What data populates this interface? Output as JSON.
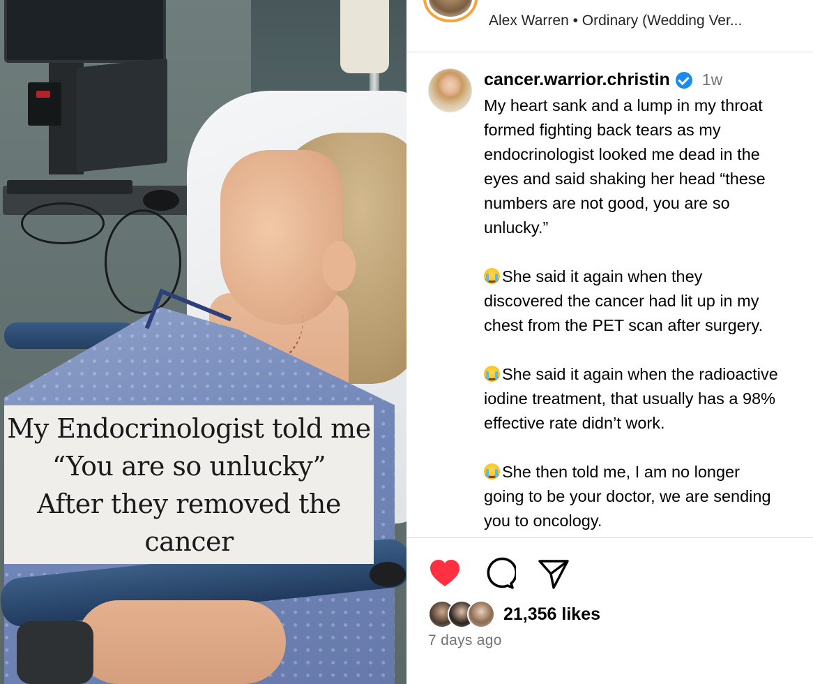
{
  "media": {
    "caption": "My Endocrinologist told me\n“You are so unlucky”\nAfter they removed the\ncancer"
  },
  "header": {
    "audio_info": "Alex Warren • Ordinary (Wedding Ver..."
  },
  "comment": {
    "username": "cancer.warrior.christin",
    "time": "1w",
    "paragraphs": [
      [
        "My heart sank and a lump in my throat",
        "formed fighting back tears as my",
        "endocrinologist looked me dead in the",
        "eyes and said shaking her head “these",
        "numbers are not good, you are so",
        "unlucky.”"
      ],
      [
        "She said it again when they",
        "discovered the cancer had lit up in my",
        "chest from the PET scan after surgery."
      ],
      [
        "She said it again when the radioactive",
        "iodine treatment, that usually has a 98%",
        "effective rate didn’t work."
      ],
      [
        "She then told me, I am no longer",
        "going to be your doctor, we are sending",
        "you to oncology."
      ]
    ],
    "emoji": "crying-face"
  },
  "actions": {
    "liked": true,
    "like_color": "#ff3040"
  },
  "likes": {
    "count_text": "21,356 likes"
  },
  "timestamp": "7 days ago",
  "colors": {
    "story_ring": "#f7a23c",
    "verified": "#1a8cf0",
    "secondary_text": "#737373",
    "divider": "#dbdbdb"
  }
}
